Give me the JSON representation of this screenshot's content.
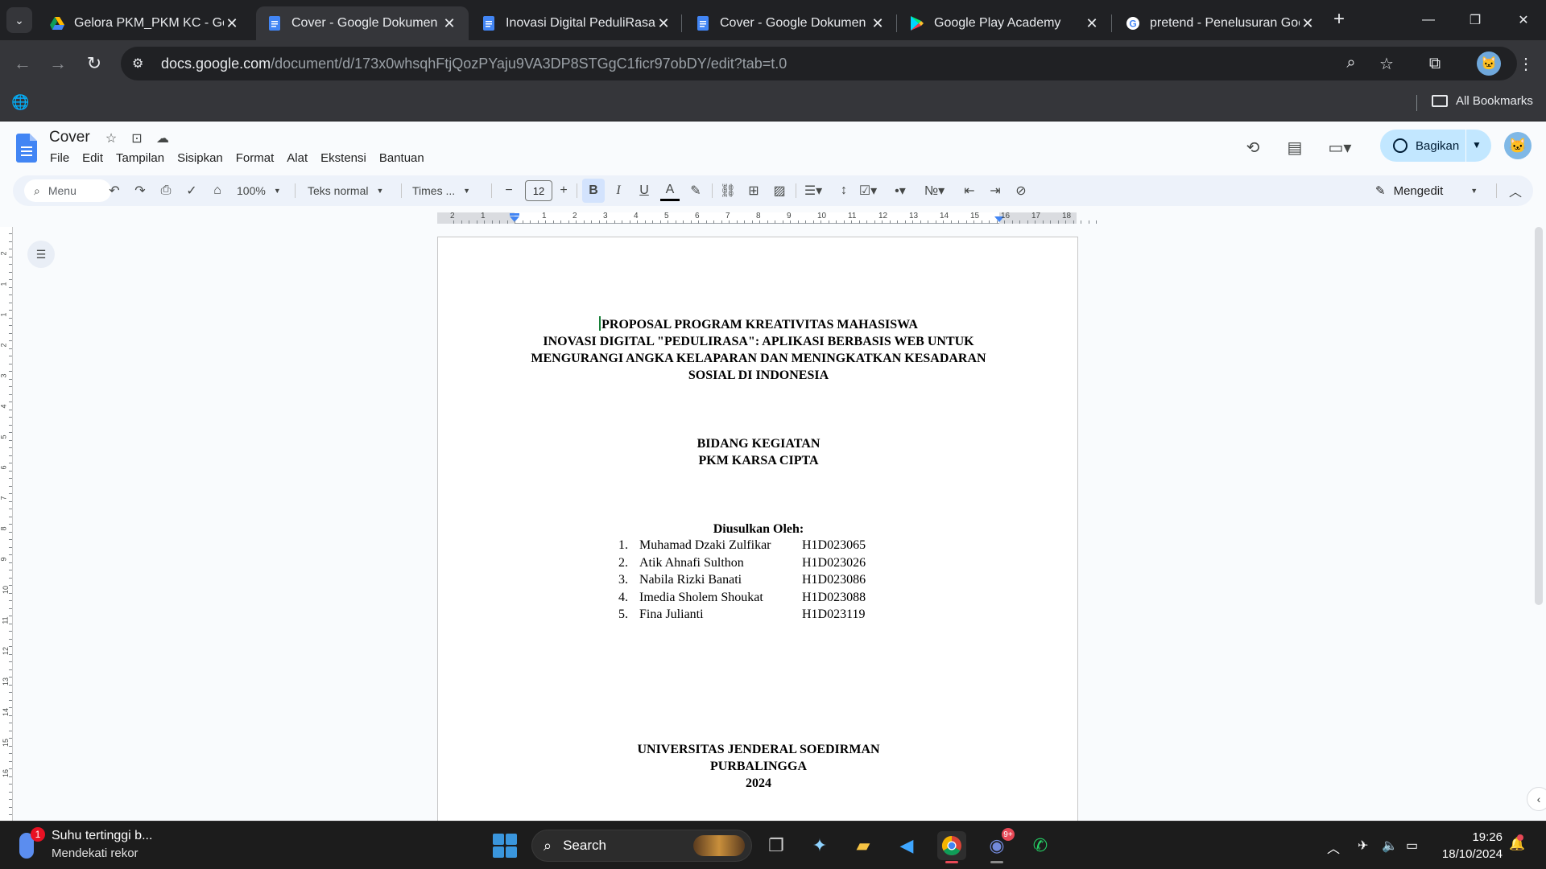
{
  "browser": {
    "tabs": [
      {
        "title": "Gelora PKM_PKM KC - Goo",
        "icon": "google-drive-icon",
        "active": false
      },
      {
        "title": "Cover - Google Dokumen",
        "icon": "google-docs-icon",
        "active": true
      },
      {
        "title": "Inovasi Digital PeduliRasa /",
        "icon": "google-docs-icon",
        "active": false
      },
      {
        "title": "Cover - Google Dokumen",
        "icon": "google-docs-icon",
        "active": false
      },
      {
        "title": "Google Play Academy",
        "icon": "google-play-icon",
        "active": false
      },
      {
        "title": "pretend - Penelusuran Goo",
        "icon": "google-icon",
        "active": false
      }
    ],
    "url_host": "docs.google.com",
    "url_path": "/document/d/173x0whsqhFtjQozPYaju9VA3DP8STGgC1ficr97obDY/edit?tab=t.0",
    "bookmarks_label": "All Bookmarks"
  },
  "docs": {
    "title": "Cover",
    "menu": [
      "File",
      "Edit",
      "Tampilan",
      "Sisipkan",
      "Format",
      "Alat",
      "Ekstensi",
      "Bantuan"
    ],
    "share_label": "Bagikan",
    "toolbar": {
      "search_placeholder": "Menu",
      "zoom": "100%",
      "style": "Teks normal",
      "font": "Times ...",
      "font_size": "12",
      "mode": "Mengedit"
    },
    "ruler_numbers": [
      "2",
      "1",
      "1",
      "2",
      "3",
      "4",
      "5",
      "6",
      "7",
      "8",
      "9",
      "10",
      "11",
      "12",
      "13",
      "14",
      "15",
      "16",
      "17",
      "18"
    ],
    "vruler_numbers": [
      "2",
      "1",
      "1",
      "2",
      "3",
      "4",
      "5",
      "6",
      "7",
      "8",
      "9",
      "10",
      "11",
      "12",
      "13",
      "14",
      "15",
      "16"
    ]
  },
  "document": {
    "title_lines": [
      "PROPOSAL PROGRAM KREATIVITAS MAHASISWA",
      "INOVASI DIGITAL \"PEDULIRASA\": APLIKASI BERBASIS WEB UNTUK",
      "MENGURANGI ANGKA KELAPARAN DAN MENINGKATKAN KESADARAN",
      "SOSIAL DI INDONESIA"
    ],
    "field_lines": [
      "BIDANG KEGIATAN",
      "PKM KARSA CIPTA"
    ],
    "proposer_heading": "Diusulkan Oleh:",
    "members": [
      {
        "no": "1.",
        "name": "Muhamad Dzaki Zulfikar",
        "id": "H1D023065"
      },
      {
        "no": "2.",
        "name": "Atik Ahnafi Sulthon",
        "id": "H1D023026"
      },
      {
        "no": "3.",
        "name": "Nabila Rizki Banati",
        "id": "H1D023086"
      },
      {
        "no": "4.",
        "name": "Imedia Sholem Shoukat",
        "id": "H1D023088"
      },
      {
        "no": "5.",
        "name": "Fina Julianti",
        "id": "H1D023119"
      }
    ],
    "footer_lines": [
      "UNIVERSITAS JENDERAL SOEDIRMAN",
      "PURBALINGGA",
      "2024"
    ]
  },
  "taskbar": {
    "weather_title": "Suhu tertinggi b...",
    "weather_sub": "Mendekati rekor",
    "weather_badge": "1",
    "search_label": "Search",
    "discord_badge": "9+",
    "time": "19:26",
    "date": "18/10/2024"
  }
}
